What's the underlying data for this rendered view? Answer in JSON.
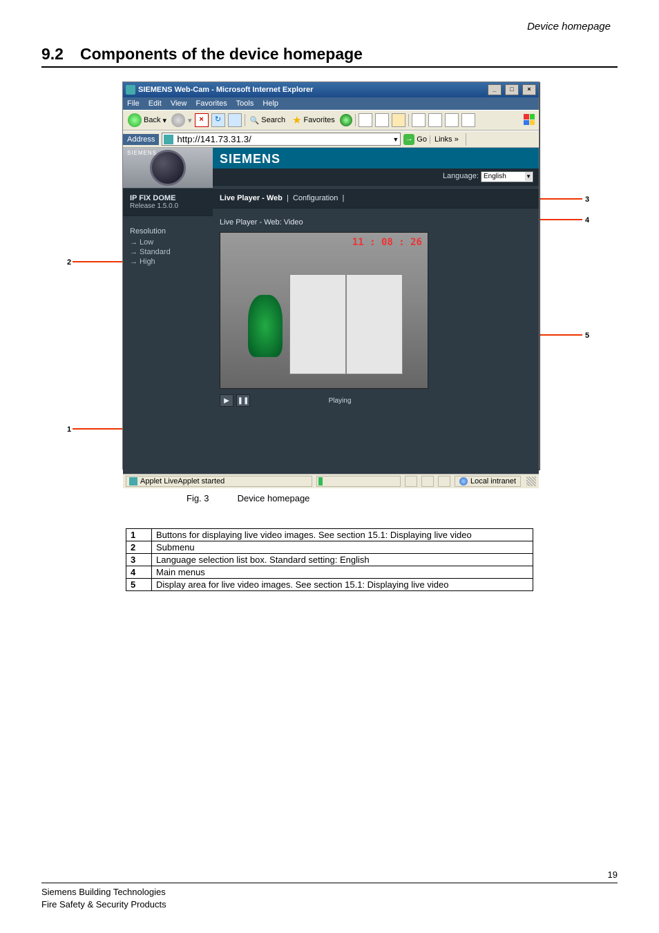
{
  "page": {
    "header_right": "Device homepage",
    "section_number": "9.2",
    "section_title": "Components of the device homepage",
    "figure_label": "Fig. 3",
    "figure_caption": "Device homepage",
    "page_number": "19"
  },
  "footer": {
    "line1": "Siemens Building Technologies",
    "line2": "Fire Safety & Security Products"
  },
  "callouts": {
    "c1": "1",
    "c2": "2",
    "c3": "3",
    "c4": "4",
    "c5": "5"
  },
  "ie": {
    "title": "SIEMENS Web-Cam - Microsoft Internet Explorer",
    "menu": {
      "file": "File",
      "edit": "Edit",
      "view": "View",
      "favorites": "Favorites",
      "tools": "Tools",
      "help": "Help"
    },
    "toolbar": {
      "back": "Back",
      "search": "Search",
      "favorites": "Favorites"
    },
    "address_label": "Address",
    "address_value": "http://141.73.31.3/",
    "go": "Go",
    "links": "Links",
    "status_text": "Applet LiveApplet started",
    "status_zone": "Local intranet"
  },
  "device": {
    "camera_label": "SIEMENS",
    "brand": "SIEMENS",
    "language_label": "Language:",
    "language_value": "English",
    "model": "IP FIX DOME",
    "release": "Release 1.5.0.0",
    "submenu_title": "Resolution",
    "submenu_items": {
      "low": "→ Low",
      "standard": "→ Standard",
      "high": "→ High"
    },
    "tab_live": "Live Player - Web",
    "tab_config": "Configuration",
    "video_title": "Live Player - Web: Video",
    "video_time": "11 : 08 : 26",
    "play_status": "Playing"
  },
  "legend": {
    "r1n": "1",
    "r1t": "Buttons for displaying live video images. See section 15.1: Displaying live video",
    "r2n": "2",
    "r2t": "Submenu",
    "r3n": "3",
    "r3t": "Language selection list box. Standard setting: English",
    "r4n": "4",
    "r4t": "Main menus",
    "r5n": "5",
    "r5t": "Display area for live video images. See section 15.1: Displaying live video"
  }
}
